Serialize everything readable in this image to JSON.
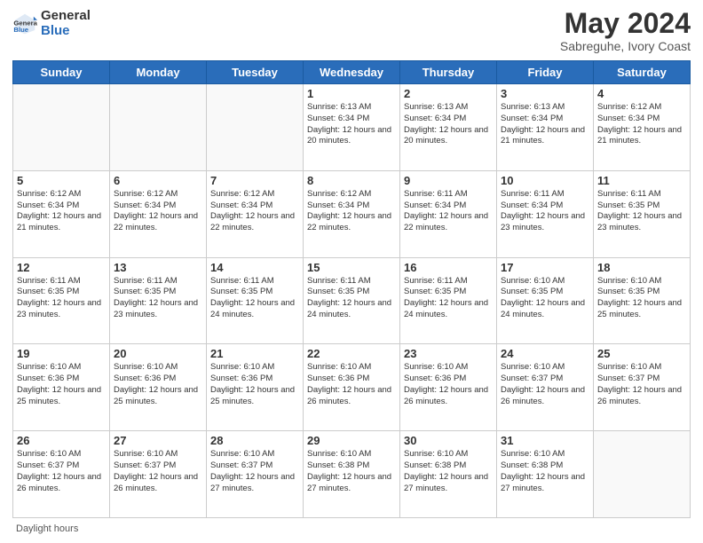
{
  "header": {
    "logo": {
      "general": "General",
      "blue": "Blue"
    },
    "title": "May 2024",
    "location": "Sabreguhe, Ivory Coast"
  },
  "days_of_week": [
    "Sunday",
    "Monday",
    "Tuesday",
    "Wednesday",
    "Thursday",
    "Friday",
    "Saturday"
  ],
  "weeks": [
    [
      {
        "day": "",
        "sunrise": "",
        "sunset": "",
        "daylight": "",
        "empty": true
      },
      {
        "day": "",
        "sunrise": "",
        "sunset": "",
        "daylight": "",
        "empty": true
      },
      {
        "day": "",
        "sunrise": "",
        "sunset": "",
        "daylight": "",
        "empty": true
      },
      {
        "day": "1",
        "sunrise": "Sunrise: 6:13 AM",
        "sunset": "Sunset: 6:34 PM",
        "daylight": "Daylight: 12 hours and 20 minutes.",
        "empty": false
      },
      {
        "day": "2",
        "sunrise": "Sunrise: 6:13 AM",
        "sunset": "Sunset: 6:34 PM",
        "daylight": "Daylight: 12 hours and 20 minutes.",
        "empty": false
      },
      {
        "day": "3",
        "sunrise": "Sunrise: 6:13 AM",
        "sunset": "Sunset: 6:34 PM",
        "daylight": "Daylight: 12 hours and 21 minutes.",
        "empty": false
      },
      {
        "day": "4",
        "sunrise": "Sunrise: 6:12 AM",
        "sunset": "Sunset: 6:34 PM",
        "daylight": "Daylight: 12 hours and 21 minutes.",
        "empty": false
      }
    ],
    [
      {
        "day": "5",
        "sunrise": "Sunrise: 6:12 AM",
        "sunset": "Sunset: 6:34 PM",
        "daylight": "Daylight: 12 hours and 21 minutes.",
        "empty": false
      },
      {
        "day": "6",
        "sunrise": "Sunrise: 6:12 AM",
        "sunset": "Sunset: 6:34 PM",
        "daylight": "Daylight: 12 hours and 22 minutes.",
        "empty": false
      },
      {
        "day": "7",
        "sunrise": "Sunrise: 6:12 AM",
        "sunset": "Sunset: 6:34 PM",
        "daylight": "Daylight: 12 hours and 22 minutes.",
        "empty": false
      },
      {
        "day": "8",
        "sunrise": "Sunrise: 6:12 AM",
        "sunset": "Sunset: 6:34 PM",
        "daylight": "Daylight: 12 hours and 22 minutes.",
        "empty": false
      },
      {
        "day": "9",
        "sunrise": "Sunrise: 6:11 AM",
        "sunset": "Sunset: 6:34 PM",
        "daylight": "Daylight: 12 hours and 22 minutes.",
        "empty": false
      },
      {
        "day": "10",
        "sunrise": "Sunrise: 6:11 AM",
        "sunset": "Sunset: 6:34 PM",
        "daylight": "Daylight: 12 hours and 23 minutes.",
        "empty": false
      },
      {
        "day": "11",
        "sunrise": "Sunrise: 6:11 AM",
        "sunset": "Sunset: 6:35 PM",
        "daylight": "Daylight: 12 hours and 23 minutes.",
        "empty": false
      }
    ],
    [
      {
        "day": "12",
        "sunrise": "Sunrise: 6:11 AM",
        "sunset": "Sunset: 6:35 PM",
        "daylight": "Daylight: 12 hours and 23 minutes.",
        "empty": false
      },
      {
        "day": "13",
        "sunrise": "Sunrise: 6:11 AM",
        "sunset": "Sunset: 6:35 PM",
        "daylight": "Daylight: 12 hours and 23 minutes.",
        "empty": false
      },
      {
        "day": "14",
        "sunrise": "Sunrise: 6:11 AM",
        "sunset": "Sunset: 6:35 PM",
        "daylight": "Daylight: 12 hours and 24 minutes.",
        "empty": false
      },
      {
        "day": "15",
        "sunrise": "Sunrise: 6:11 AM",
        "sunset": "Sunset: 6:35 PM",
        "daylight": "Daylight: 12 hours and 24 minutes.",
        "empty": false
      },
      {
        "day": "16",
        "sunrise": "Sunrise: 6:11 AM",
        "sunset": "Sunset: 6:35 PM",
        "daylight": "Daylight: 12 hours and 24 minutes.",
        "empty": false
      },
      {
        "day": "17",
        "sunrise": "Sunrise: 6:10 AM",
        "sunset": "Sunset: 6:35 PM",
        "daylight": "Daylight: 12 hours and 24 minutes.",
        "empty": false
      },
      {
        "day": "18",
        "sunrise": "Sunrise: 6:10 AM",
        "sunset": "Sunset: 6:35 PM",
        "daylight": "Daylight: 12 hours and 25 minutes.",
        "empty": false
      }
    ],
    [
      {
        "day": "19",
        "sunrise": "Sunrise: 6:10 AM",
        "sunset": "Sunset: 6:36 PM",
        "daylight": "Daylight: 12 hours and 25 minutes.",
        "empty": false
      },
      {
        "day": "20",
        "sunrise": "Sunrise: 6:10 AM",
        "sunset": "Sunset: 6:36 PM",
        "daylight": "Daylight: 12 hours and 25 minutes.",
        "empty": false
      },
      {
        "day": "21",
        "sunrise": "Sunrise: 6:10 AM",
        "sunset": "Sunset: 6:36 PM",
        "daylight": "Daylight: 12 hours and 25 minutes.",
        "empty": false
      },
      {
        "day": "22",
        "sunrise": "Sunrise: 6:10 AM",
        "sunset": "Sunset: 6:36 PM",
        "daylight": "Daylight: 12 hours and 26 minutes.",
        "empty": false
      },
      {
        "day": "23",
        "sunrise": "Sunrise: 6:10 AM",
        "sunset": "Sunset: 6:36 PM",
        "daylight": "Daylight: 12 hours and 26 minutes.",
        "empty": false
      },
      {
        "day": "24",
        "sunrise": "Sunrise: 6:10 AM",
        "sunset": "Sunset: 6:37 PM",
        "daylight": "Daylight: 12 hours and 26 minutes.",
        "empty": false
      },
      {
        "day": "25",
        "sunrise": "Sunrise: 6:10 AM",
        "sunset": "Sunset: 6:37 PM",
        "daylight": "Daylight: 12 hours and 26 minutes.",
        "empty": false
      }
    ],
    [
      {
        "day": "26",
        "sunrise": "Sunrise: 6:10 AM",
        "sunset": "Sunset: 6:37 PM",
        "daylight": "Daylight: 12 hours and 26 minutes.",
        "empty": false
      },
      {
        "day": "27",
        "sunrise": "Sunrise: 6:10 AM",
        "sunset": "Sunset: 6:37 PM",
        "daylight": "Daylight: 12 hours and 26 minutes.",
        "empty": false
      },
      {
        "day": "28",
        "sunrise": "Sunrise: 6:10 AM",
        "sunset": "Sunset: 6:37 PM",
        "daylight": "Daylight: 12 hours and 27 minutes.",
        "empty": false
      },
      {
        "day": "29",
        "sunrise": "Sunrise: 6:10 AM",
        "sunset": "Sunset: 6:38 PM",
        "daylight": "Daylight: 12 hours and 27 minutes.",
        "empty": false
      },
      {
        "day": "30",
        "sunrise": "Sunrise: 6:10 AM",
        "sunset": "Sunset: 6:38 PM",
        "daylight": "Daylight: 12 hours and 27 minutes.",
        "empty": false
      },
      {
        "day": "31",
        "sunrise": "Sunrise: 6:10 AM",
        "sunset": "Sunset: 6:38 PM",
        "daylight": "Daylight: 12 hours and 27 minutes.",
        "empty": false
      },
      {
        "day": "",
        "sunrise": "",
        "sunset": "",
        "daylight": "",
        "empty": true
      }
    ]
  ],
  "footer": {
    "daylight_label": "Daylight hours"
  }
}
